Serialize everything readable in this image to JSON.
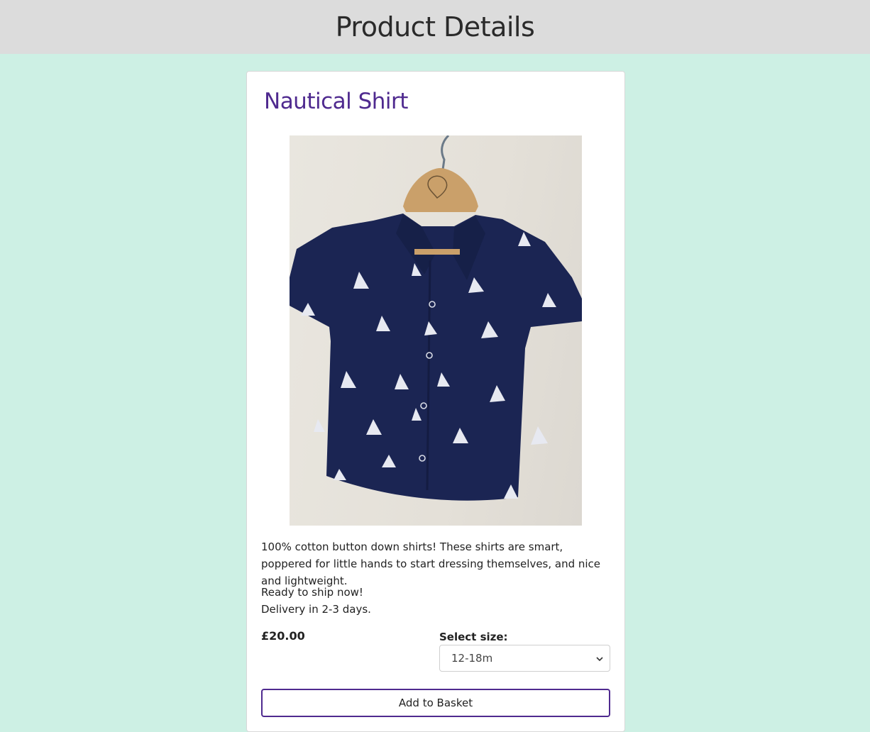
{
  "header": {
    "title": "Product Details"
  },
  "product": {
    "name": "Nautical Shirt",
    "image_alt": "navy-shirt-with-white-sailboat-print-on-wooden-hanger",
    "description": "100% cotton button down shirts! These shirts are smart, poppered for little hands to start dressing themselves, and nice and lightweight.",
    "availability": [
      "Ready to ship now!",
      "Delivery in 2-3 days."
    ],
    "price": "£20.00"
  },
  "size": {
    "label": "Select size:",
    "selected": "12-18m"
  },
  "actions": {
    "add_to_basket": "Add to Basket"
  },
  "colors": {
    "background": "#cdf0e4",
    "header_bg": "#dcdcdc",
    "accent": "#4f2a8f",
    "shirt": "#1b2553"
  }
}
